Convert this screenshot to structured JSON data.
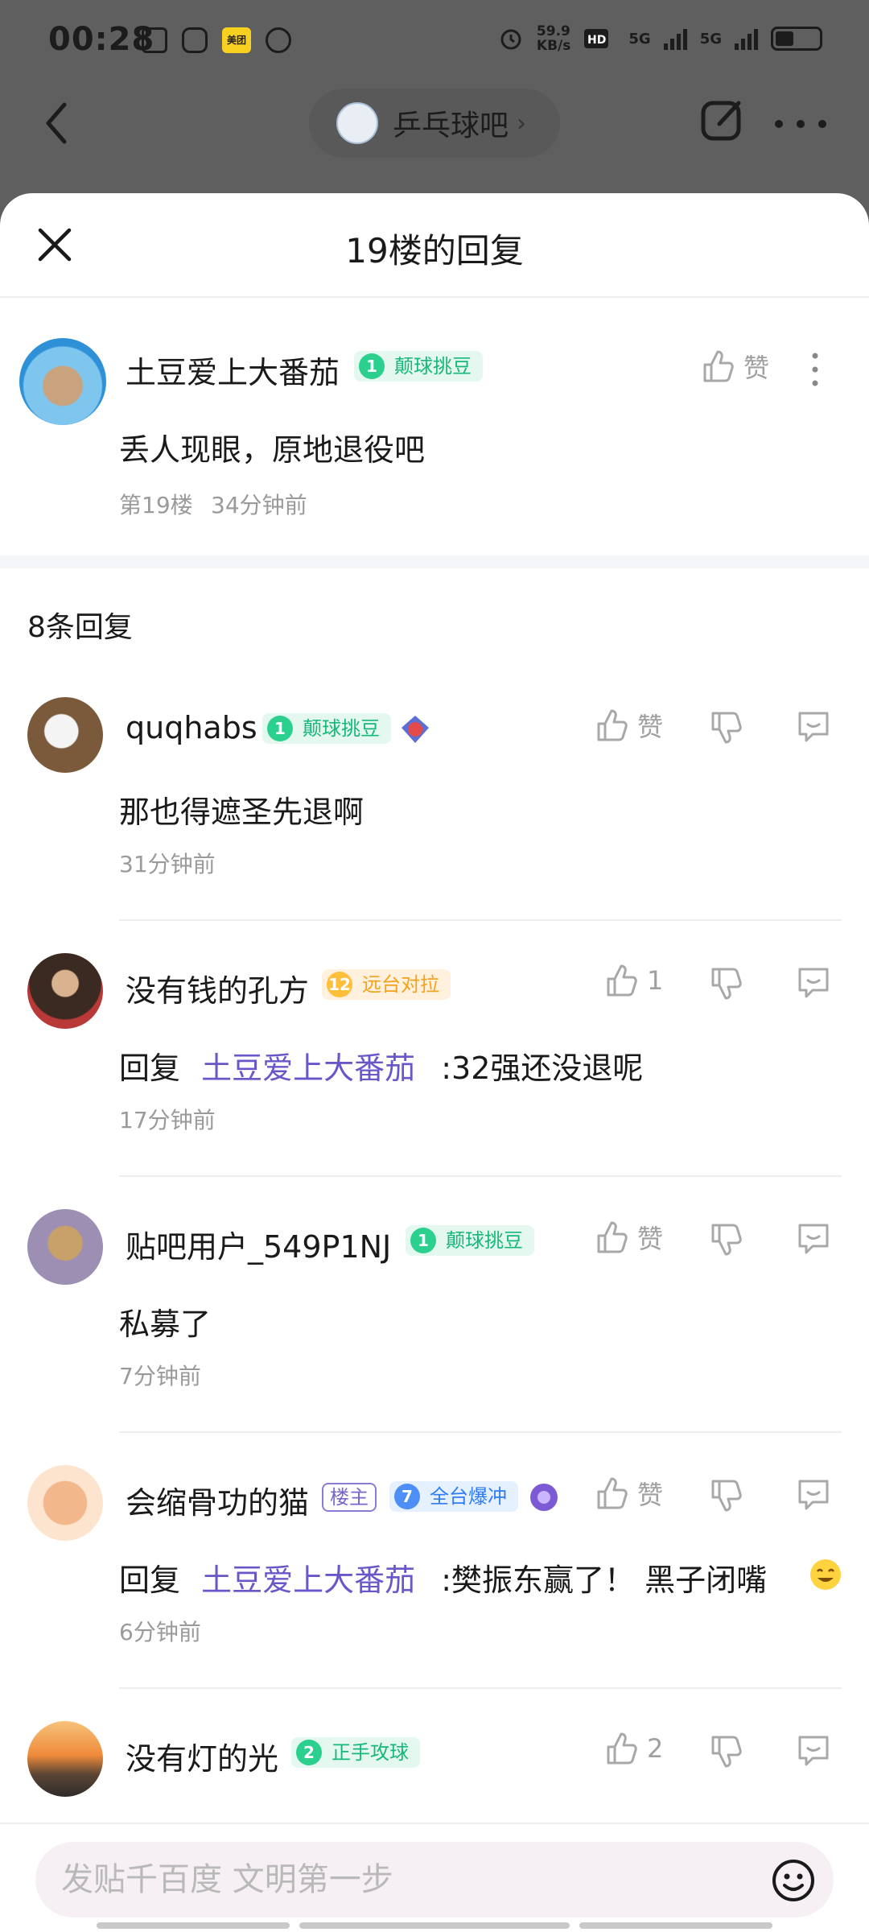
{
  "status_bar": {
    "time": "00:28",
    "net_speed_value": "59.9",
    "net_speed_unit": "KB/s",
    "network_1": "5G",
    "network_2": "5G",
    "meituan_label": "美团"
  },
  "nav": {
    "forum_name": "乒乓球吧",
    "forum_chevron": "›"
  },
  "sheet": {
    "title": "19楼的回复"
  },
  "main_post": {
    "username": "土豆爱上大番茄",
    "badge_level": "1",
    "badge_title": "颠球挑豆",
    "like_label": "赞",
    "content": "丢人现眼，原地退役吧",
    "floor": "第19楼",
    "time": "34分钟前"
  },
  "reply_count_label": "8条回复",
  "replies": [
    {
      "username": "quqhabs",
      "badge_level": "1",
      "badge_title": "颠球挑豆",
      "badge_color": "green",
      "like_label": "赞",
      "content": "那也得遮圣先退啊",
      "time": "31分钟前"
    },
    {
      "username": "没有钱的孔方",
      "badge_level": "12",
      "badge_title": "远台对拉",
      "badge_color": "orange",
      "like_label": "1",
      "reply_prefix": "回复",
      "reply_to": "土豆爱上大番茄",
      "content": ":32强还没退呢",
      "time": "17分钟前"
    },
    {
      "username": "贴吧用户_549P1NJ",
      "badge_level": "1",
      "badge_title": "颠球挑豆",
      "badge_color": "green",
      "like_label": "赞",
      "content": "私募了",
      "time": "7分钟前"
    },
    {
      "username": "会缩骨功的猫",
      "owner_tag": "楼主",
      "badge_level": "7",
      "badge_title": "全台爆冲",
      "badge_color": "blue",
      "like_label": "赞",
      "reply_prefix": "回复",
      "reply_to": "土豆爱上大番茄",
      "content": ":樊振东赢了！ 黑子闭嘴",
      "time": "6分钟前"
    },
    {
      "username": "没有灯的光",
      "badge_level": "2",
      "badge_title": "正手攻球",
      "badge_color": "green",
      "like_label": "2"
    }
  ],
  "input": {
    "placeholder": "发贴千百度 文明第一步"
  },
  "icons": {
    "back": "back-arrow-icon",
    "edit": "edit-icon",
    "more": "more-icon",
    "close": "close-icon",
    "like": "thumbs-up-icon",
    "dislike": "thumbs-down-icon",
    "comment": "comment-icon",
    "emoji": "emoji-icon"
  }
}
